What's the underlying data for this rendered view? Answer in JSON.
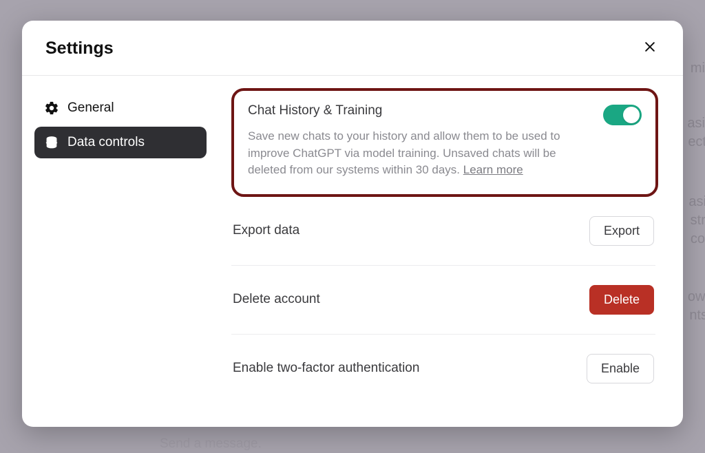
{
  "modal": {
    "title": "Settings"
  },
  "sidebar": {
    "items": [
      {
        "label": "General"
      },
      {
        "label": "Data controls"
      }
    ]
  },
  "chatHistory": {
    "title": "Chat History & Training",
    "desc_part1": "Save new chats to your history and allow them to be used to improve ChatGPT via model training. Unsaved chats will be deleted from our systems within 30 days. ",
    "learn_more": "Learn more",
    "toggle_on": true
  },
  "rows": {
    "export": {
      "label": "Export data",
      "button": "Export"
    },
    "delete": {
      "label": "Delete account",
      "button": "Delete"
    },
    "two_factor": {
      "label": "Enable two-factor authentication",
      "button": "Enable"
    }
  },
  "background": {
    "send_message": "Send a message.",
    "frag1": "mi",
    "frag2": "asic",
    "frag3": "ect",
    "frag4": "asi",
    "frag5": "stru",
    "frag6": "co",
    "frag7": "owle",
    "frag8": "nts"
  }
}
